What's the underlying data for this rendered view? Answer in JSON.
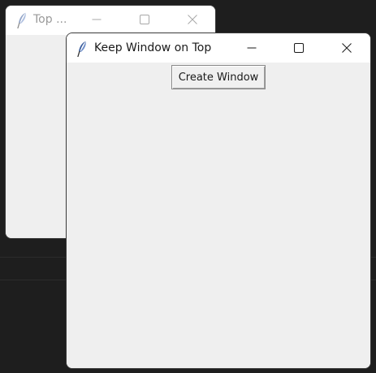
{
  "desktop": {
    "background": "#1e1e1e"
  },
  "back_window": {
    "title": "Top ...",
    "icon": "feather-icon",
    "controls": [
      "minimize-icon",
      "maximize-icon",
      "close-icon"
    ]
  },
  "front_window": {
    "title": "Keep Window on Top",
    "icon": "feather-icon",
    "controls": [
      "minimize-icon",
      "maximize-icon",
      "close-icon"
    ],
    "create_button_label": "Create Window"
  },
  "colors": {
    "window_bg": "#efefef",
    "titlebar_bg": "#ffffff",
    "feather_blue": "#3d5f9e"
  }
}
